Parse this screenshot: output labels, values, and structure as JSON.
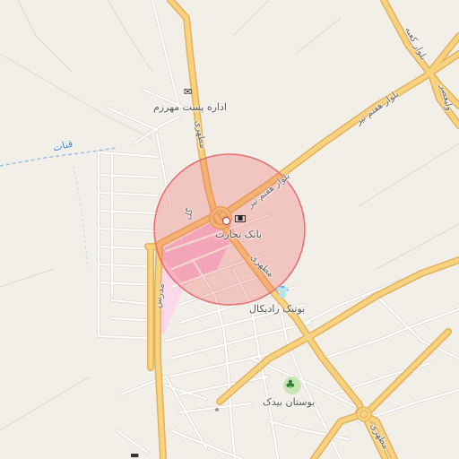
{
  "map": {
    "colors": {
      "background": "#f2efe9",
      "major_road": "#fad07a",
      "major_road_casing": "#e6b35a",
      "minor_road": "#ffffff",
      "minor_road_casing": "#d6d2c8",
      "water_label": "#3a86c6",
      "highlight_circle_fill": "rgba(240,80,80,0.28)",
      "highlight_circle_stroke": "#e36a6a",
      "pink_area": "#f7b7dc",
      "park": "#b7dfa4"
    },
    "labels": {
      "post_office": "اداره پست مهرزم",
      "bank": "بانک تجارت",
      "boutique": "بوتیک رادیکال",
      "park": "بوستان بیدک",
      "road_haftom_tir_1": "بلوار هفتم تیر",
      "road_haftom_tir_2": "بلوار هفتم تیر",
      "road_motahari_1": "مطهری",
      "road_motahari_2": "مطهری",
      "road_motahari_3": "مطهری",
      "road_kaabe": "بلوار کعبه",
      "road_valiasr": "ولیعصر",
      "road_gol": "گل",
      "road_modares": "مدرس",
      "canal": "قنات"
    },
    "icons": {
      "post_office": "envelope-icon",
      "bank": "banknote-icon",
      "boutique": "shirt-icon",
      "park": "tree-icon",
      "bottom_poi": "bed-icon"
    }
  }
}
